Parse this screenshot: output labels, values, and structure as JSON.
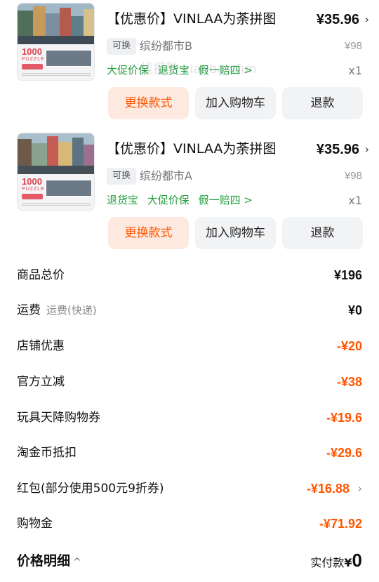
{
  "watermark": "线报酷 xianbao.fun",
  "products": [
    {
      "thumb_big": "1000",
      "thumb_small": "PUZZLE",
      "title": "【优惠价】VINLAA为荼拼图",
      "price": "¥35.96",
      "swap_badge": "可换",
      "variant": "缤纷都市B",
      "orig_price": "¥98",
      "services": [
        "大促价保",
        "退货宝",
        "假一赔四 >"
      ],
      "qty": "x1",
      "btn_change": "更换款式",
      "btn_cart": "加入购物车",
      "btn_refund": "退款"
    },
    {
      "thumb_big": "1000",
      "thumb_small": "PUZZLE",
      "title": "【优惠价】VINLAA为荼拼图",
      "price": "¥35.96",
      "swap_badge": "可换",
      "variant": "缤纷都市A",
      "orig_price": "¥98",
      "services": [
        "退货宝",
        "大促价保",
        "假一赔四 >"
      ],
      "qty": "x1",
      "btn_change": "更换款式",
      "btn_cart": "加入购物车",
      "btn_refund": "退款"
    }
  ],
  "summary": [
    {
      "label": "商品总价",
      "value": "¥196"
    },
    {
      "label": "运费",
      "sub": "运费(快递)",
      "value": "¥0"
    },
    {
      "label": "店铺优惠",
      "value": "-¥20"
    },
    {
      "label": "官方立减",
      "value": "-¥38"
    },
    {
      "label": "玩具天降购物券",
      "value": "-¥19.6"
    },
    {
      "label": "淘金币抵扣",
      "value": "-¥29.6"
    },
    {
      "label": "红包(部分使用500元9折券)",
      "value": "-¥16.88"
    },
    {
      "label": "购物金",
      "value": "-¥71.92"
    }
  ],
  "footer": {
    "details_label": "价格明细",
    "details_icon": "^",
    "paid_label": "实付款",
    "currency": "¥",
    "paid_amount": "0"
  },
  "colors": {
    "accent": "#ff5500",
    "service_green": "#22a13d"
  }
}
